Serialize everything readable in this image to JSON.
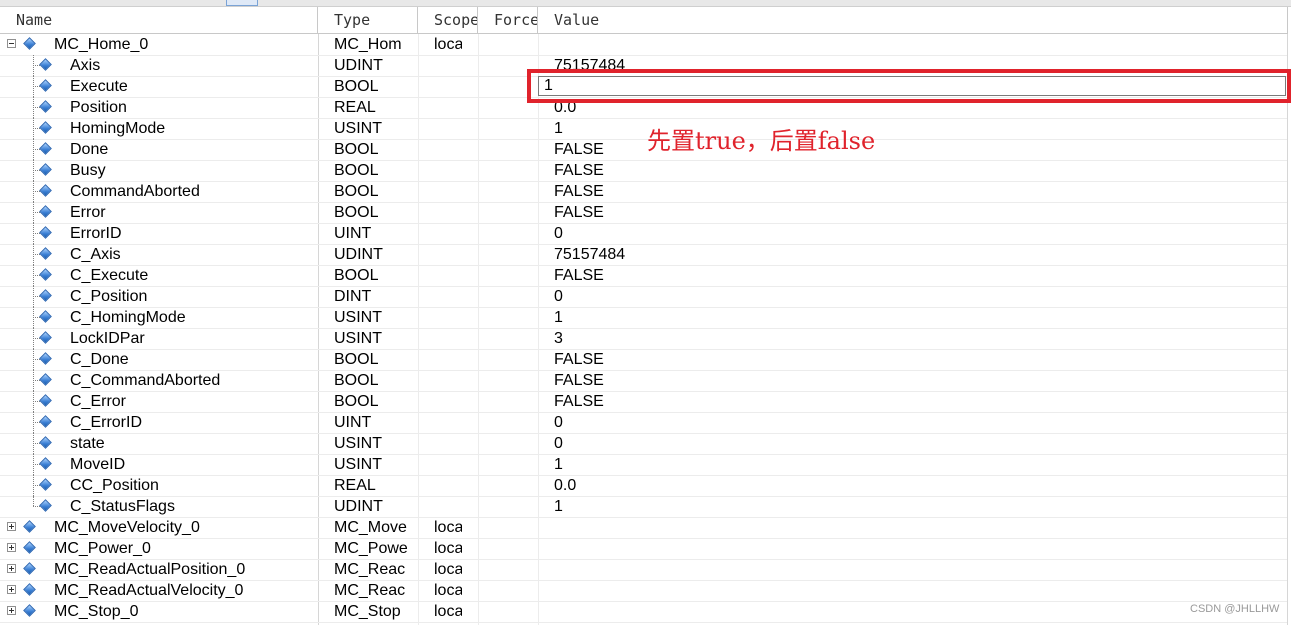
{
  "columns": {
    "name": "Name",
    "type": "Type",
    "scope": "Scope",
    "force": "Force",
    "value": "Value"
  },
  "rows": [
    {
      "name": "MC_Home_0",
      "type": "MC_Hom",
      "scope": "loca",
      "value": "",
      "level": 0,
      "expander": "minus"
    },
    {
      "name": "Axis",
      "type": "UDINT",
      "scope": "",
      "value": "75157484",
      "level": 1
    },
    {
      "name": "Execute",
      "type": "BOOL",
      "scope": "",
      "value": "",
      "level": 1
    },
    {
      "name": "Position",
      "type": "REAL",
      "scope": "",
      "value": "0.0",
      "level": 1
    },
    {
      "name": "HomingMode",
      "type": "USINT",
      "scope": "",
      "value": "1",
      "level": 1
    },
    {
      "name": "Done",
      "type": "BOOL",
      "scope": "",
      "value": "FALSE",
      "level": 1
    },
    {
      "name": "Busy",
      "type": "BOOL",
      "scope": "",
      "value": "FALSE",
      "level": 1
    },
    {
      "name": "CommandAborted",
      "type": "BOOL",
      "scope": "",
      "value": "FALSE",
      "level": 1
    },
    {
      "name": "Error",
      "type": "BOOL",
      "scope": "",
      "value": "FALSE",
      "level": 1
    },
    {
      "name": "ErrorID",
      "type": "UINT",
      "scope": "",
      "value": "0",
      "level": 1
    },
    {
      "name": "C_Axis",
      "type": "UDINT",
      "scope": "",
      "value": "75157484",
      "level": 1
    },
    {
      "name": "C_Execute",
      "type": "BOOL",
      "scope": "",
      "value": "FALSE",
      "level": 1
    },
    {
      "name": "C_Position",
      "type": "DINT",
      "scope": "",
      "value": "0",
      "level": 1
    },
    {
      "name": "C_HomingMode",
      "type": "USINT",
      "scope": "",
      "value": "1",
      "level": 1
    },
    {
      "name": "LockIDPar",
      "type": "USINT",
      "scope": "",
      "value": "3",
      "level": 1
    },
    {
      "name": "C_Done",
      "type": "BOOL",
      "scope": "",
      "value": "FALSE",
      "level": 1
    },
    {
      "name": "C_CommandAborted",
      "type": "BOOL",
      "scope": "",
      "value": "FALSE",
      "level": 1
    },
    {
      "name": "C_Error",
      "type": "BOOL",
      "scope": "",
      "value": "FALSE",
      "level": 1
    },
    {
      "name": "C_ErrorID",
      "type": "UINT",
      "scope": "",
      "value": "0",
      "level": 1
    },
    {
      "name": "state",
      "type": "USINT",
      "scope": "",
      "value": "0",
      "level": 1
    },
    {
      "name": "MoveID",
      "type": "USINT",
      "scope": "",
      "value": "1",
      "level": 1
    },
    {
      "name": "CC_Position",
      "type": "REAL",
      "scope": "",
      "value": "0.0",
      "level": 1
    },
    {
      "name": "C_StatusFlags",
      "type": "UDINT",
      "scope": "",
      "value": "1",
      "level": 1,
      "last": true
    },
    {
      "name": "MC_MoveVelocity_0",
      "type": "MC_Move",
      "scope": "loca",
      "value": "",
      "level": 0,
      "expander": "plus"
    },
    {
      "name": "MC_Power_0",
      "type": "MC_Powe",
      "scope": "loca",
      "value": "",
      "level": 0,
      "expander": "plus"
    },
    {
      "name": "MC_ReadActualPosition_0",
      "type": "MC_Reac",
      "scope": "loca",
      "value": "",
      "level": 0,
      "expander": "plus"
    },
    {
      "name": "MC_ReadActualVelocity_0",
      "type": "MC_Reac",
      "scope": "loca",
      "value": "",
      "level": 0,
      "expander": "plus"
    },
    {
      "name": "MC_Stop_0",
      "type": "MC_Stop",
      "scope": "loca",
      "value": "",
      "level": 0,
      "expander": "plus"
    }
  ],
  "edit_field": {
    "value": "1"
  },
  "annotation": {
    "text": "先置true，后置false",
    "color": "#e0232c"
  },
  "watermark": "CSDN @JHLLHW",
  "icons": {
    "variable": "variable-diamond-icon",
    "collapse": "tree-collapse-icon",
    "expand": "tree-expand-icon"
  }
}
